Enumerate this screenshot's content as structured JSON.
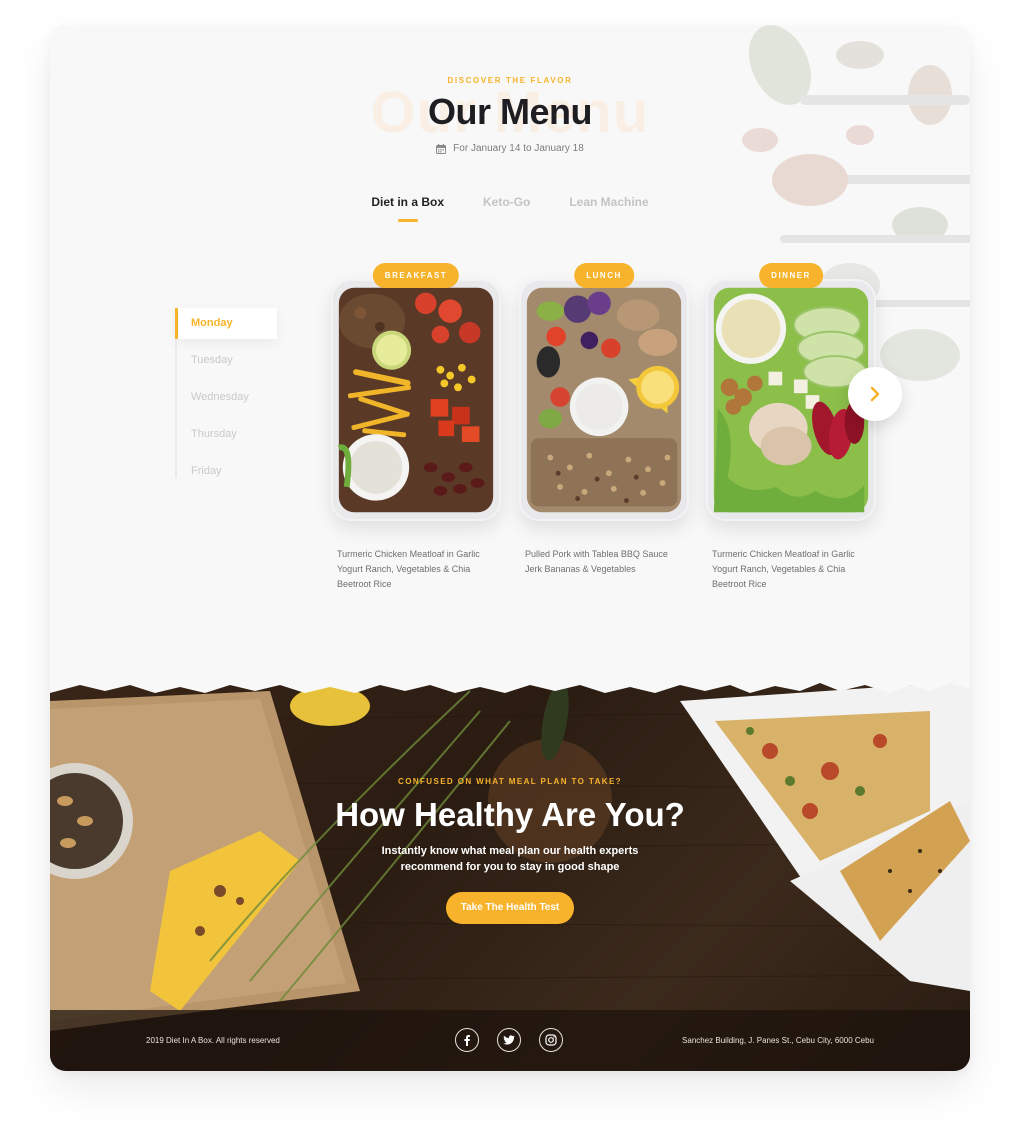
{
  "menu": {
    "eyebrow": "DISCOVER THE FLAVOR",
    "ghost_word": "Our Menu",
    "title": "Our Menu",
    "date_range": "For January 14 to January 18",
    "calendar_icon": "calendar-icon"
  },
  "tabs": [
    {
      "label": "Diet in a Box",
      "active": true
    },
    {
      "label": "Keto-Go",
      "active": false
    },
    {
      "label": "Lean Machine",
      "active": false
    }
  ],
  "days": [
    {
      "label": "Monday",
      "active": true
    },
    {
      "label": "Tuesday",
      "active": false
    },
    {
      "label": "Wednesday",
      "active": false
    },
    {
      "label": "Thursday",
      "active": false
    },
    {
      "label": "Friday",
      "active": false
    }
  ],
  "meals": [
    {
      "badge": "BREAKFAST",
      "description": "Turmeric Chicken Meatloaf in Garlic Yogurt Ranch, Vegetables & Chia Beetroot Rice"
    },
    {
      "badge": "LUNCH",
      "description": "Pulled Pork with Tablea BBQ Sauce Jerk Bananas & Vegetables"
    },
    {
      "badge": "DINNER",
      "description": "Turmeric Chicken Meatloaf in Garlic Yogurt Ranch, Vegetables & Chia Beetroot Rice"
    }
  ],
  "carousel": {
    "next_icon": "chevron-right-icon"
  },
  "health": {
    "eyebrow": "CONFUSED ON WHAT MEAL PLAN TO TAKE?",
    "title": "How Healthy Are You?",
    "subtitle": "Instantly know what meal plan our health experts recommend for you to stay in good shape",
    "cta": "Take The Health Test"
  },
  "footer": {
    "copyright": "2019 Diet In A Box. All rights reserved",
    "address": "Sanchez Building, J. Panes St., Cebu City, 6000 Cebu",
    "socials": [
      "facebook-icon",
      "twitter-icon",
      "instagram-icon"
    ]
  },
  "colors": {
    "accent": "#f6b32b",
    "title": "#1d1d22",
    "muted": "#c4c4c4",
    "wood": "#3a2618"
  }
}
